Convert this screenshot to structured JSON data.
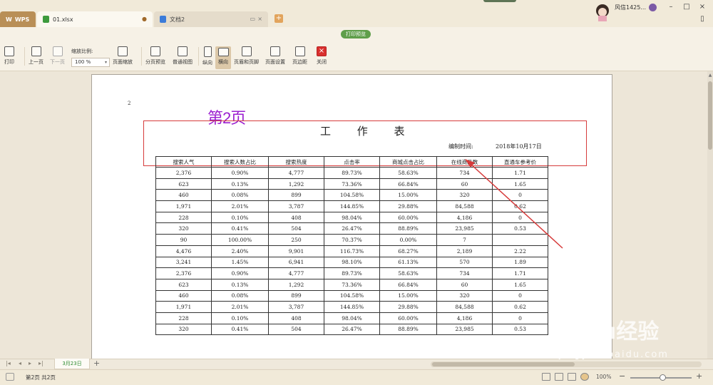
{
  "tabs": {
    "wps": "WPS",
    "file1": "01.xlsx",
    "file2": "文档2"
  },
  "user": {
    "name": "风信1425..."
  },
  "toolbar": {
    "mode_title": "打印预览",
    "print": "打印",
    "prev_page": "上一页",
    "next_page": "下一页",
    "zoom_label": "缩放比例:",
    "zoom_value": "100 %",
    "page_scale": "页面缩放",
    "page_break_preview": "分页预览",
    "normal_view": "普通视图",
    "portrait": "纵向",
    "landscape": "横向",
    "header_footer": "页眉和页脚",
    "page_setup": "页面设置",
    "margins": "页边距",
    "close": "关闭"
  },
  "page": {
    "number": "2",
    "annotation": "第2页",
    "title": "工 作 表",
    "compile_label": "编制时间:",
    "compile_date": "2018年10月17日"
  },
  "table": {
    "headers": [
      "搜索人气",
      "搜索人数占比",
      "搜索热度",
      "点击率",
      "商城点击占比",
      "在线商品数",
      "直通车参考价"
    ],
    "rows": [
      [
        "2,376",
        "0.90%",
        "4,777",
        "89.73%",
        "58.63%",
        "734",
        "1.71"
      ],
      [
        "623",
        "0.13%",
        "1,292",
        "73.36%",
        "66.84%",
        "60",
        "1.65"
      ],
      [
        "460",
        "0.08%",
        "899",
        "104.58%",
        "15.00%",
        "320",
        "0"
      ],
      [
        "1,971",
        "2.01%",
        "3,787",
        "144.85%",
        "29.88%",
        "84,588",
        "0.62"
      ],
      [
        "228",
        "0.10%",
        "408",
        "98.04%",
        "60.00%",
        "4,186",
        "0"
      ],
      [
        "320",
        "0.41%",
        "504",
        "26.47%",
        "88.89%",
        "23,985",
        "0.53"
      ],
      [
        "90",
        "100.00%",
        "250",
        "70.37%",
        "0.00%",
        "7",
        ""
      ],
      [
        "4,476",
        "2.40%",
        "9,901",
        "116.73%",
        "68.27%",
        "2,189",
        "2.22"
      ],
      [
        "3,241",
        "1.45%",
        "6,941",
        "98.10%",
        "61.13%",
        "570",
        "1.89"
      ],
      [
        "2,376",
        "0.90%",
        "4,777",
        "89.73%",
        "58.63%",
        "734",
        "1.71"
      ],
      [
        "623",
        "0.13%",
        "1,292",
        "73.36%",
        "66.84%",
        "60",
        "1.65"
      ],
      [
        "460",
        "0.08%",
        "899",
        "104.58%",
        "15.00%",
        "320",
        "0"
      ],
      [
        "1,971",
        "2.01%",
        "3,787",
        "144.85%",
        "29.88%",
        "84,588",
        "0.62"
      ],
      [
        "228",
        "0.10%",
        "408",
        "98.04%",
        "60.00%",
        "4,186",
        "0"
      ],
      [
        "320",
        "0.41%",
        "504",
        "26.47%",
        "88.89%",
        "23,985",
        "0.53"
      ]
    ]
  },
  "sheetbar": {
    "sheet_name": "3月23日"
  },
  "status": {
    "page_info": "第2页 共2页",
    "zoom": "100%"
  },
  "watermark": {
    "brand": "Baidu经验",
    "url": "jingyan.baidu.com"
  },
  "colors": {
    "accent": "#5f9e4a",
    "annotation": "#9b1fd0",
    "highlight": "#d63b3b"
  }
}
